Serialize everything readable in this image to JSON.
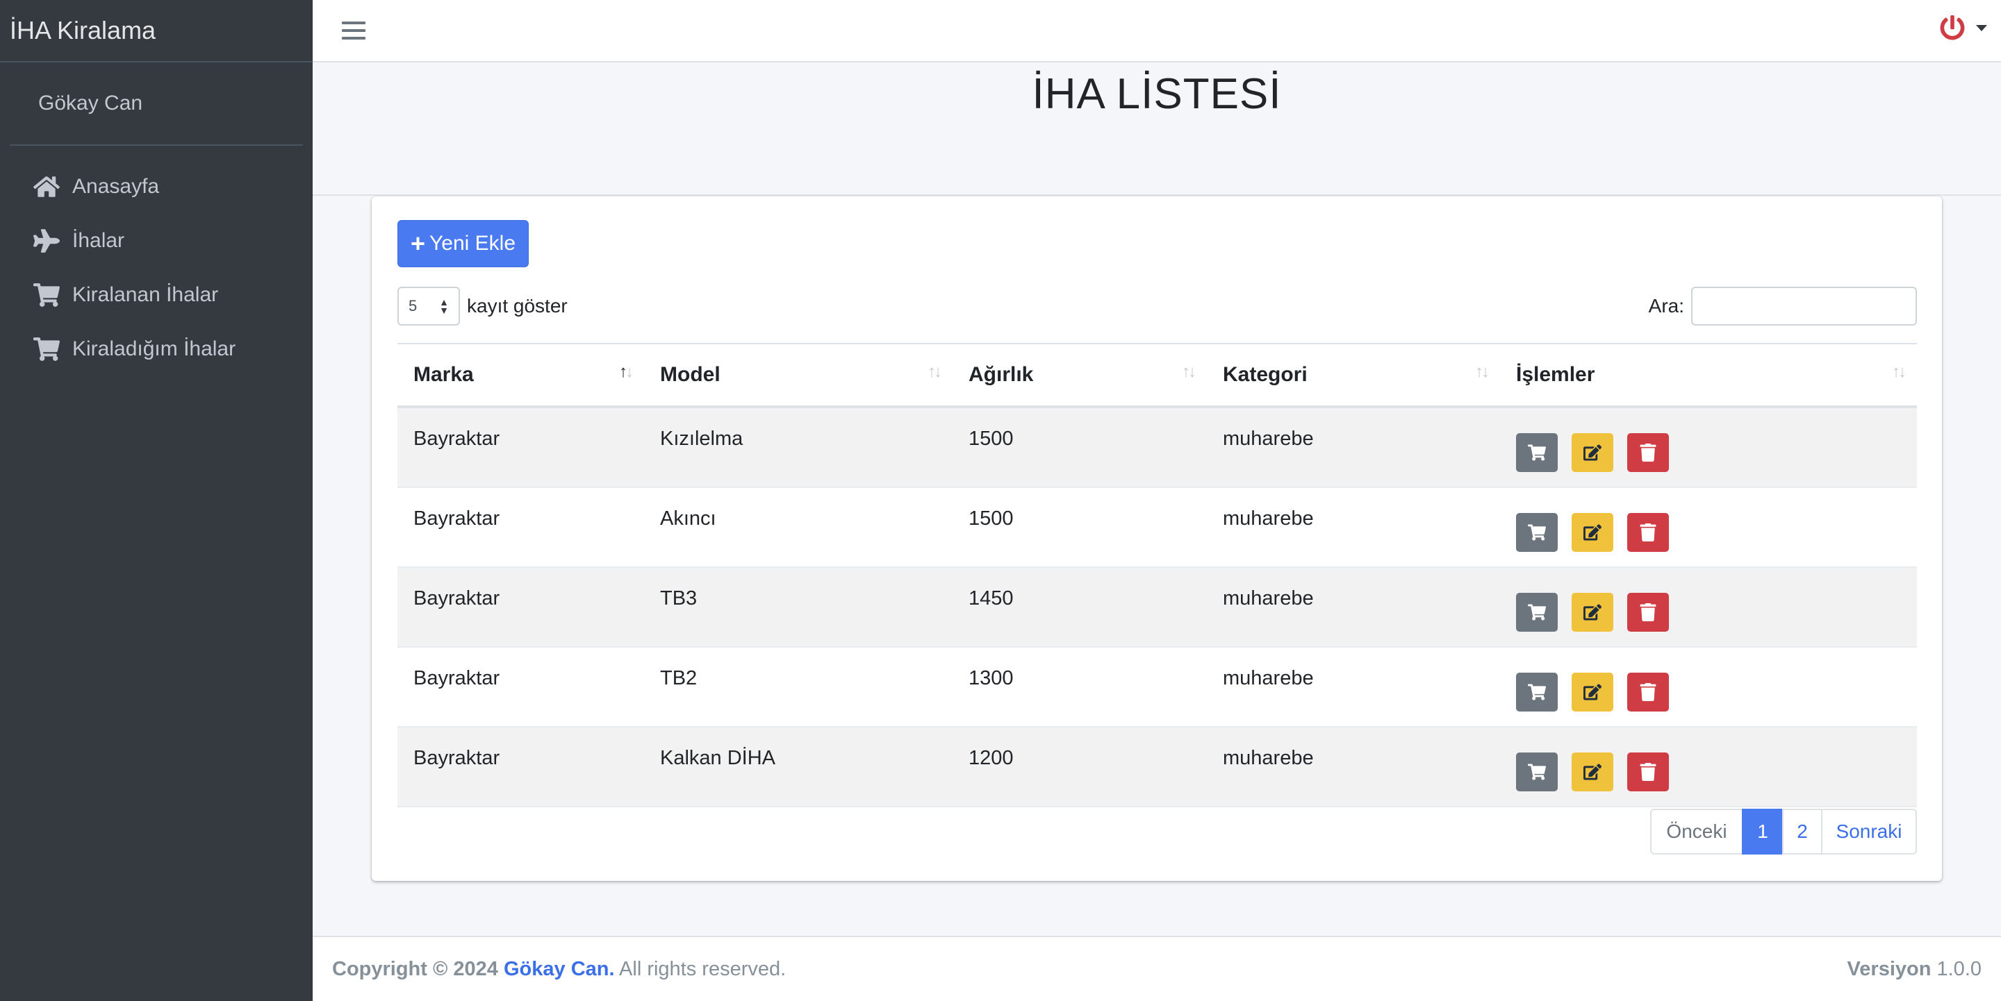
{
  "brand": "İHA Kiralama",
  "user": "Gökay Can",
  "sidebar": {
    "items": [
      {
        "label": "Anasayfa",
        "icon": "home-icon"
      },
      {
        "label": "İhalar",
        "icon": "plane-icon"
      },
      {
        "label": "Kiralanan İhalar",
        "icon": "cart-icon"
      },
      {
        "label": "Kiraladığım İhalar",
        "icon": "cart-icon"
      }
    ]
  },
  "page": {
    "title": "İHA LİSTESİ"
  },
  "toolbar": {
    "new_label": "Yeni Ekle",
    "new_icon": "plus-icon"
  },
  "length": {
    "value": "5",
    "suffix": "kayıt göster"
  },
  "search": {
    "label": "Ara:",
    "value": ""
  },
  "table": {
    "headers": [
      "Marka",
      "Model",
      "Ağırlık",
      "Kategori",
      "İşlemler"
    ],
    "sorted_column": "Marka",
    "sort_direction": "ascending",
    "rows": [
      {
        "marka": "Bayraktar",
        "model": "Kızılelma",
        "agirlik": "1500",
        "kategori": "muharebe"
      },
      {
        "marka": "Bayraktar",
        "model": "Akıncı",
        "agirlik": "1500",
        "kategori": "muharebe"
      },
      {
        "marka": "Bayraktar",
        "model": "TB3",
        "agirlik": "1450",
        "kategori": "muharebe"
      },
      {
        "marka": "Bayraktar",
        "model": "TB2",
        "agirlik": "1300",
        "kategori": "muharebe"
      },
      {
        "marka": "Bayraktar",
        "model": "Kalkan DİHA",
        "agirlik": "1200",
        "kategori": "muharebe"
      }
    ],
    "row_actions": [
      "cart-icon",
      "edit-icon",
      "trash-icon"
    ]
  },
  "pagination": {
    "prev": "Önceki",
    "pages": [
      "1",
      "2"
    ],
    "active": "1",
    "next": "Sonraki"
  },
  "footer": {
    "copyright_prefix": "Copyright © 2024",
    "author": "Gökay Can.",
    "rights": "All rights reserved.",
    "version_label": "Versiyon",
    "version": "1.0.0"
  },
  "colors": {
    "sidebar_bg": "#343a40",
    "primary": "#4a7af0",
    "warning": "#f0c23b",
    "danger": "#d03c44",
    "secondary": "#6c757d",
    "power": "#d03c44"
  }
}
